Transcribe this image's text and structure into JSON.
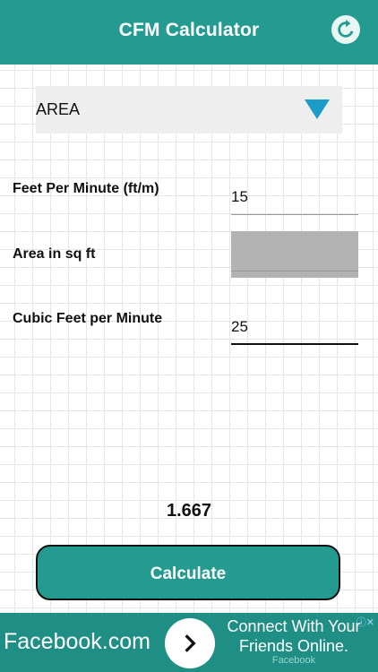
{
  "app": {
    "title": "CFM Calculator"
  },
  "dropdown": {
    "selected": "AREA"
  },
  "fields": [
    {
      "label": "Feet Per Minute (ft/m)",
      "value": "15"
    },
    {
      "label": "Area in sq ft",
      "value": ""
    },
    {
      "label": "Cubic Feet per Minute",
      "value": "25"
    }
  ],
  "result": "1.667",
  "calculate_label": "Calculate",
  "ad": {
    "brand": "Facebook.com",
    "headline_line1": "Connect With Your",
    "headline_line2": "Friends Online.",
    "sub": "Facebook",
    "adchoices": "ⓘ✕"
  },
  "colors": {
    "primary": "#239b91",
    "dropdown_arrow": "#1b9dc8",
    "disabled_field": "#b3b3b3"
  }
}
